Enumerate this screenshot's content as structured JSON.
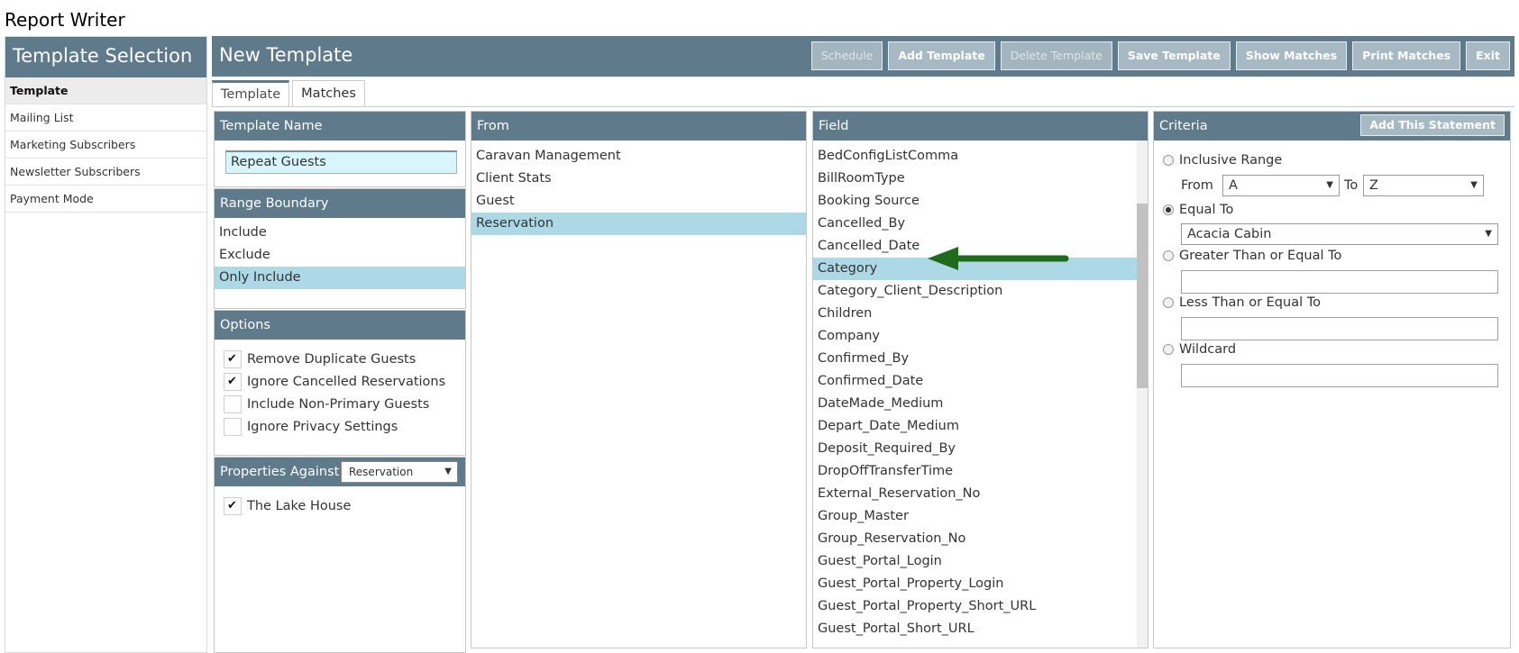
{
  "app": {
    "title": "Report Writer"
  },
  "sidebar": {
    "header": "Template Selection",
    "items": [
      {
        "label": "Template",
        "active": true
      },
      {
        "label": "Mailing List",
        "active": false
      },
      {
        "label": "Marketing Subscribers",
        "active": false
      },
      {
        "label": "Newsletter Subscribers",
        "active": false
      },
      {
        "label": "Payment Mode",
        "active": false
      }
    ]
  },
  "header": {
    "title": "New Template",
    "buttons": [
      {
        "label": "Schedule",
        "enabled": false
      },
      {
        "label": "Add Template",
        "enabled": true
      },
      {
        "label": "Delete Template",
        "enabled": false
      },
      {
        "label": "Save Template",
        "enabled": true
      },
      {
        "label": "Show Matches",
        "enabled": true
      },
      {
        "label": "Print Matches",
        "enabled": true
      },
      {
        "label": "Exit",
        "enabled": true
      }
    ]
  },
  "tabs": [
    {
      "label": "Template",
      "active": true
    },
    {
      "label": "Matches",
      "active": false
    }
  ],
  "template_name": {
    "header": "Template Name",
    "value": "Repeat Guests"
  },
  "range_boundary": {
    "header": "Range Boundary",
    "items": [
      "Include",
      "Exclude",
      "Only Include"
    ],
    "selected": "Only Include"
  },
  "options": {
    "header": "Options",
    "items": [
      {
        "label": "Remove Duplicate Guests",
        "checked": true
      },
      {
        "label": "Ignore Cancelled Reservations",
        "checked": true
      },
      {
        "label": "Include Non-Primary Guests",
        "checked": false
      },
      {
        "label": "Ignore Privacy Settings",
        "checked": false
      }
    ]
  },
  "properties": {
    "header": "Properties Against",
    "select_value": "Reservation",
    "items": [
      {
        "label": "The Lake House",
        "checked": true
      }
    ]
  },
  "from": {
    "header": "From",
    "items": [
      "Caravan Management",
      "Client Stats",
      "Guest",
      "Reservation"
    ],
    "selected": "Reservation"
  },
  "field": {
    "header": "Field",
    "items": [
      "BedConfigListComma",
      "BillRoomType",
      "Booking Source",
      "Cancelled_By",
      "Cancelled_Date",
      "Category",
      "Category_Client_Description",
      "Children",
      "Company",
      "Confirmed_By",
      "Confirmed_Date",
      "DateMade_Medium",
      "Depart_Date_Medium",
      "Deposit_Required_By",
      "DropOffTransferTime",
      "External_Reservation_No",
      "Group_Master",
      "Group_Reservation_No",
      "Guest_Portal_Login",
      "Guest_Portal_Property_Login",
      "Guest_Portal_Property_Short_URL",
      "Guest_Portal_Short_URL"
    ],
    "selected": "Category",
    "annotation_color": "#1e6b1e"
  },
  "criteria": {
    "header": "Criteria",
    "add_button": "Add This Statement",
    "inclusive_range": "Inclusive Range",
    "from_label": "From",
    "from_value": "A",
    "to_label": "To",
    "to_value": "Z",
    "equal_to": "Equal To",
    "equal_value": "Acacia Cabin",
    "gte": "Greater Than or Equal To",
    "lte": "Less Than or Equal To",
    "wildcard": "Wildcard",
    "selected_mode": "Equal To"
  },
  "colors": {
    "header_bg": "#5e7a8b",
    "selected_row": "#add8e6",
    "input_bg": "#d7f5fb"
  }
}
